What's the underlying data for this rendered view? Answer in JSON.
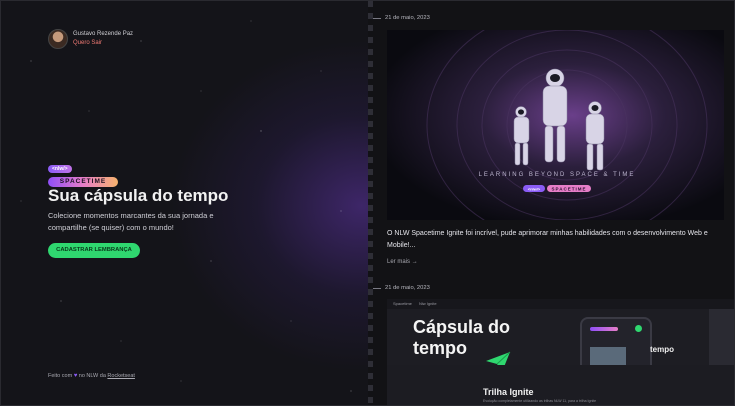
{
  "profile": {
    "name": "Gustavo Rezende Paz",
    "action": "Quero Sair"
  },
  "brand": {
    "badge": "<nlw/>",
    "wordmark": "SPACETIME"
  },
  "hero": {
    "title": "Sua cápsula do tempo",
    "subtitle": "Colecione momentos marcantes da sua jornada e compartilhe (se quiser) com o mundo!",
    "cta": "CADASTRAR LEMBRANÇA"
  },
  "footer": {
    "prefix": "Feito com",
    "heart": "♥",
    "middle": "no NLW da",
    "link": "Rocketseat"
  },
  "memories": [
    {
      "date": "21 de maio, 2023",
      "cover_tagline": "LEARNING BEYOND SPACE & TIME",
      "cover_badge": "<nlw/>",
      "cover_wordmark": "SPACETIME",
      "text": "O NLW Spacetime Ignite foi incrível, pude aprimorar minhas habilidades com o desenvolvimento Web e Mobile!...",
      "link": "Ler mais"
    },
    {
      "date": "21 de maio, 2023",
      "cover_tabs": [
        "Spacetime",
        "Nlw Ignite"
      ],
      "cover_headline": "Cápsula do tempo",
      "cover_phone_title": "tempo",
      "cover_section": "Trilha Ignite",
      "cover_caption": "Evolução completamente utilizando as trilhas NLW 11, para a trilha Ignite"
    }
  ],
  "colors": {
    "accent_green": "#2fd76f",
    "accent_purple": "#8a5cf6",
    "link_red": "#f07a74",
    "background": "#121215"
  },
  "icons": {
    "arrow": "→",
    "heart": "♥"
  }
}
